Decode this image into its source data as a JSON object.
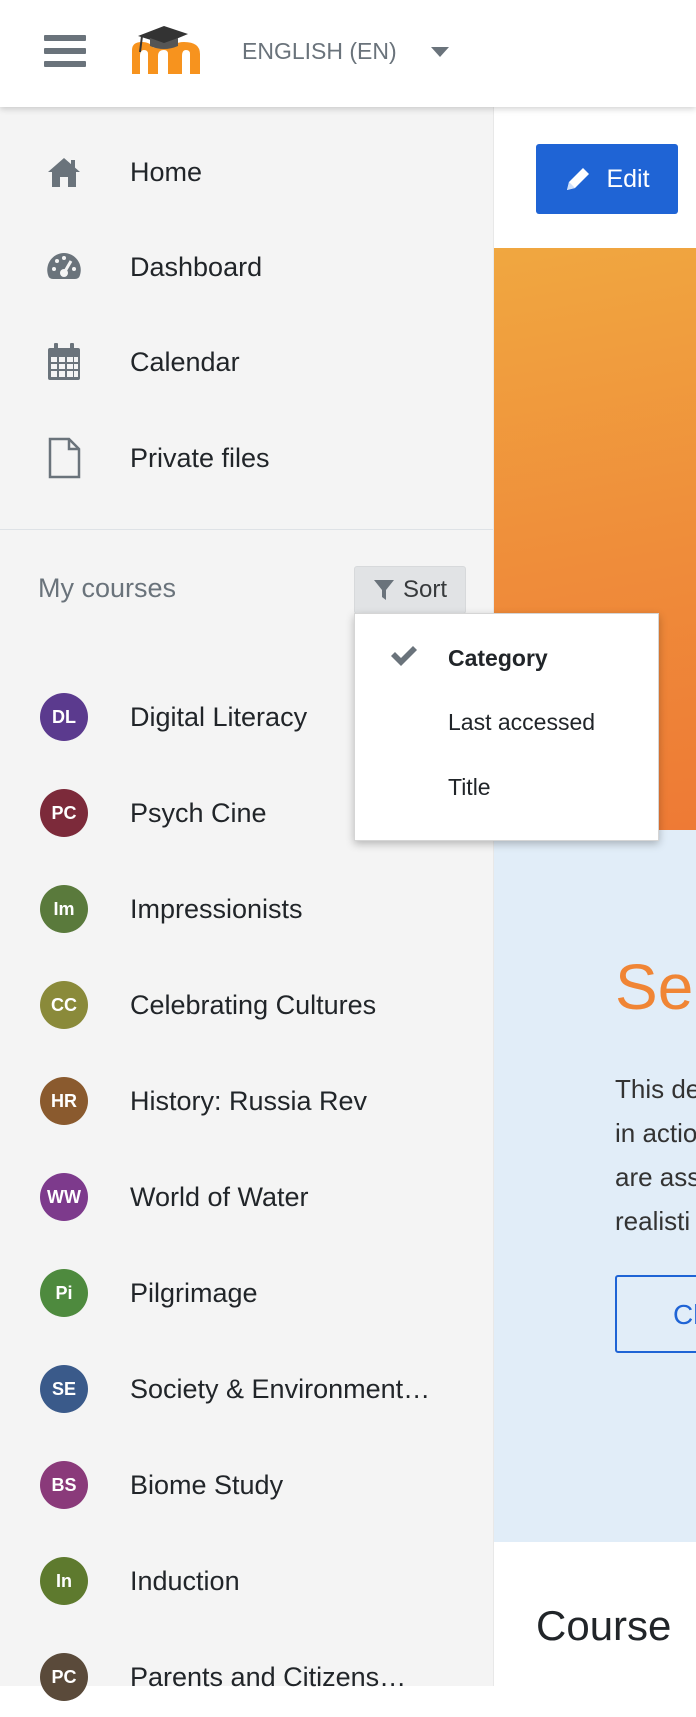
{
  "navbar": {
    "language": "ENGLISH (EN)"
  },
  "drawer": {
    "nav": [
      {
        "label": "Home",
        "icon": "home-icon"
      },
      {
        "label": "Dashboard",
        "icon": "dashboard-icon"
      },
      {
        "label": "Calendar",
        "icon": "calendar-icon"
      },
      {
        "label": "Private files",
        "icon": "file-icon"
      }
    ],
    "my_courses_label": "My courses",
    "sort_label": "Sort",
    "courses": [
      {
        "initials": "DL",
        "name": "Digital Literacy",
        "color": "#5b3a8e"
      },
      {
        "initials": "PC",
        "name": "Psych Cine",
        "color": "#7c2a3a"
      },
      {
        "initials": "Im",
        "name": "Impressionists",
        "color": "#5a7a3c"
      },
      {
        "initials": "CC",
        "name": "Celebrating Cultures",
        "color": "#8a8a3a"
      },
      {
        "initials": "HR",
        "name": "History: Russia Rev",
        "color": "#8a5a2e"
      },
      {
        "initials": "WW",
        "name": "World of Water",
        "color": "#7d3a8c"
      },
      {
        "initials": "Pi",
        "name": "Pilgrimage",
        "color": "#4e8a3e"
      },
      {
        "initials": "SE",
        "name": "Society & Environment…",
        "color": "#3a5a8a"
      },
      {
        "initials": "BS",
        "name": "Biome Study",
        "color": "#8a3a7a"
      },
      {
        "initials": "In",
        "name": "Induction",
        "color": "#5e7a2e"
      },
      {
        "initials": "PC",
        "name": "Parents and Citizens…",
        "color": "#5a4a3a"
      }
    ]
  },
  "sort_menu": {
    "items": [
      {
        "label": "Category",
        "selected": true
      },
      {
        "label": "Last accessed",
        "selected": false
      },
      {
        "label": "Title",
        "selected": false
      }
    ]
  },
  "main": {
    "edit_label": "Edit",
    "blue_heading": "See",
    "blue_text_lines": [
      "This de",
      "in actio",
      "are ass",
      "realisti"
    ],
    "blue_button": "Cl",
    "course_heading": "Course"
  },
  "colors": {
    "primary": "#1f64d5",
    "accent": "#f08535"
  }
}
